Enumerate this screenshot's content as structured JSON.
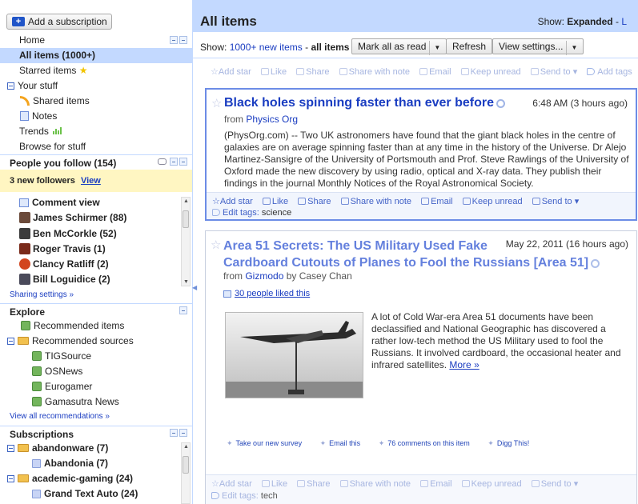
{
  "sidebar": {
    "add_subscription": "Add a subscription",
    "nav": {
      "home": "Home",
      "all_items": "All items (1000+)",
      "starred": "Starred items",
      "your_stuff": "Your stuff",
      "shared": "Shared items",
      "notes": "Notes",
      "trends": "Trends",
      "browse": "Browse for stuff"
    },
    "people": {
      "header": "People you follow (154)",
      "new_followers": "3 new followers",
      "view": "View",
      "comment_view": "Comment view",
      "items": [
        {
          "label": "James Schirmer (88)",
          "avatar_color": "#6b4a3a"
        },
        {
          "label": "Ben McCorkle (52)",
          "avatar_color": "#3b3b3b"
        },
        {
          "label": "Roger Travis (1)",
          "avatar_color": "#7a2a1a"
        },
        {
          "label": "Clancy Ratliff (2)",
          "avatar_color": "#d2451e"
        },
        {
          "label": "Bill Loguidice (2)",
          "avatar_color": "#4a4a5a"
        }
      ],
      "sharing_settings": "Sharing settings »"
    },
    "explore": {
      "header": "Explore",
      "recommended_items": "Recommended items",
      "recommended_sources": "Recommended sources",
      "sources": [
        "TIGSource",
        "OSNews",
        "Eurogamer",
        "Gamasutra News"
      ],
      "view_all": "View all recommendations »"
    },
    "subscriptions": {
      "header": "Subscriptions",
      "items": [
        {
          "label": "abandonware (7)",
          "type": "folder"
        },
        {
          "label": "Abandonia (7)",
          "type": "feed"
        },
        {
          "label": "academic-gaming (24)",
          "type": "folder"
        },
        {
          "label": "Grand Text Auto (24)",
          "type": "feed"
        }
      ]
    }
  },
  "main": {
    "title": "All items",
    "show_label": "Show:",
    "show_value": "Expanded",
    "show_sep": " - ",
    "show_list": "L",
    "toolbar": {
      "show": "Show:",
      "new_items": "1000+ new items",
      "sep": " - ",
      "all_items": "all items",
      "mark_all_read": "Mark all as read",
      "refresh": "Refresh",
      "view_settings": "View settings..."
    },
    "actions": {
      "add_star": "Add star",
      "like": "Like",
      "share": "Share",
      "share_note": "Share with note",
      "email": "Email",
      "keep_unread": "Keep unread",
      "send_to": "Send to",
      "add_tags": "Add tags",
      "edit_tags": "Edit tags:"
    },
    "entries": [
      {
        "title": "Black holes spinning faster than ever before",
        "date": "6:48 AM (3 hours ago)",
        "from_label": "from",
        "source": "Physics Org",
        "body": "(PhysOrg.com) -- Two UK astronomers have found that the giant black holes in the centre of galaxies are on average spinning faster than at any time in the history of the Universe. Dr Alejo Martinez-Sansigre of the University of Portsmouth and Prof. Steve Rawlings of the University of Oxford made the new discovery by using radio, optical and X-ray data. They publish their findings in the Royal Astronomical Society.",
        "body_lines": [
          "(PhysOrg.com) -- Two UK astronomers have found that the giant black holes in the centre of",
          "galaxies are on average spinning faster than at any time in the history of the Universe. Dr Alejo",
          "Martinez-Sansigre of the University of Portsmouth and Prof. Steve Rawlings of the University of",
          "Oxford made the new discovery by using radio, optical and X-ray data. They publish their",
          "findings in the journal Monthly Notices of the Royal Astronomical Society."
        ],
        "tags": "science"
      },
      {
        "title_line1": "Area 51 Secrets: The US Military Used Fake",
        "title_line2": "Cardboard Cutouts of Planes to Fool the Russians [Area 51]",
        "date": "May 22, 2011 (16 hours ago)",
        "from_label": "from",
        "source": "Gizmodo",
        "author": " by Casey Chan",
        "liked": "30 people liked this",
        "body_lines": [
          "A lot of Cold War-era Area 51 documents have been",
          "declassified and National Geographic has discovered a",
          "rather low-tech method the US Military used to fool the",
          "Russians. It involved cardboard, the occasional heater and",
          "infrared satellites."
        ],
        "more": "More »",
        "footer_links": [
          "Take our new survey",
          "Email this",
          "76 comments on this item",
          "Digg This!"
        ],
        "tags": "tech"
      }
    ]
  }
}
